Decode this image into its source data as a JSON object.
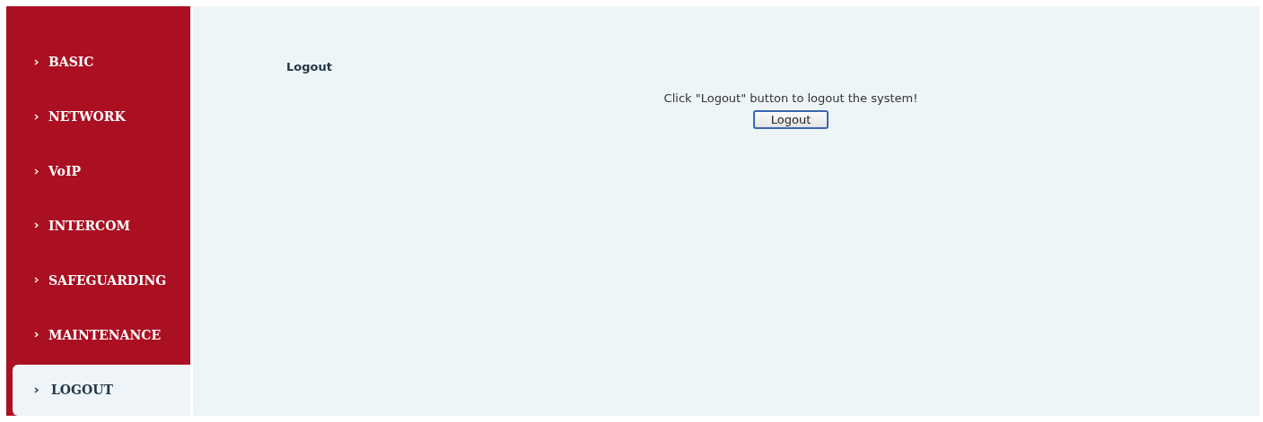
{
  "sidebar": {
    "items": [
      {
        "label": "BASIC",
        "selected": false
      },
      {
        "label": "NETWORK",
        "selected": false
      },
      {
        "label": "VoIP",
        "selected": false
      },
      {
        "label": "INTERCOM",
        "selected": false
      },
      {
        "label": "SAFEGUARDING",
        "selected": false
      },
      {
        "label": "MAINTENANCE",
        "selected": false
      },
      {
        "label": "LOGOUT",
        "selected": true
      }
    ]
  },
  "content": {
    "title": "Logout",
    "message": "Click \"Logout\" button to logout the system!",
    "button": "Logout"
  }
}
